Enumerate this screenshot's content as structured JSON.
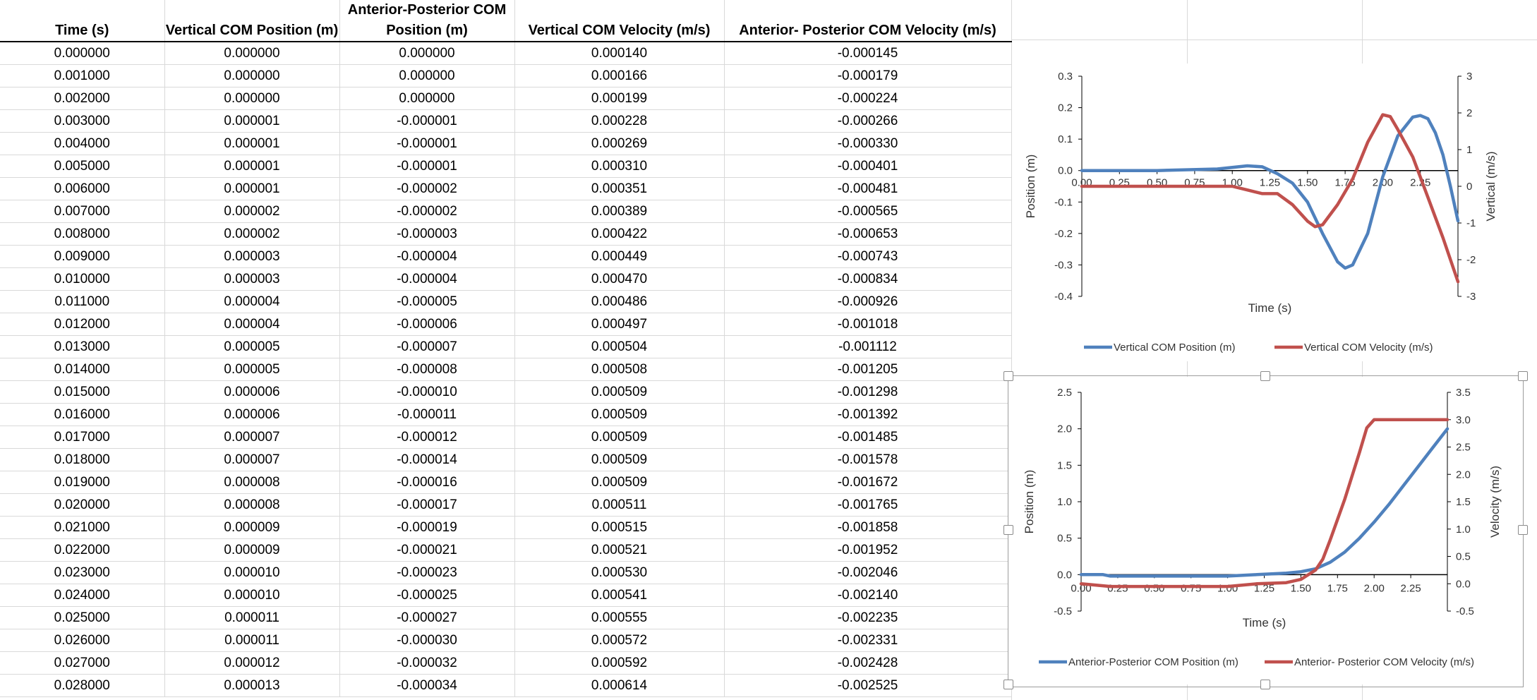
{
  "table": {
    "columns": [
      "Time (s)",
      "Vertical COM Position (m)",
      "Anterior-Posterior COM Position (m)",
      "Vertical COM Velocity (m/s)",
      "Anterior- Posterior COM Velocity (m/s)"
    ],
    "rows": [
      [
        "0.000000",
        "0.000000",
        "0.000000",
        "0.000140",
        "-0.000145"
      ],
      [
        "0.001000",
        "0.000000",
        "0.000000",
        "0.000166",
        "-0.000179"
      ],
      [
        "0.002000",
        "0.000000",
        "0.000000",
        "0.000199",
        "-0.000224"
      ],
      [
        "0.003000",
        "0.000001",
        "-0.000001",
        "0.000228",
        "-0.000266"
      ],
      [
        "0.004000",
        "0.000001",
        "-0.000001",
        "0.000269",
        "-0.000330"
      ],
      [
        "0.005000",
        "0.000001",
        "-0.000001",
        "0.000310",
        "-0.000401"
      ],
      [
        "0.006000",
        "0.000001",
        "-0.000002",
        "0.000351",
        "-0.000481"
      ],
      [
        "0.007000",
        "0.000002",
        "-0.000002",
        "0.000389",
        "-0.000565"
      ],
      [
        "0.008000",
        "0.000002",
        "-0.000003",
        "0.000422",
        "-0.000653"
      ],
      [
        "0.009000",
        "0.000003",
        "-0.000004",
        "0.000449",
        "-0.000743"
      ],
      [
        "0.010000",
        "0.000003",
        "-0.000004",
        "0.000470",
        "-0.000834"
      ],
      [
        "0.011000",
        "0.000004",
        "-0.000005",
        "0.000486",
        "-0.000926"
      ],
      [
        "0.012000",
        "0.000004",
        "-0.000006",
        "0.000497",
        "-0.001018"
      ],
      [
        "0.013000",
        "0.000005",
        "-0.000007",
        "0.000504",
        "-0.001112"
      ],
      [
        "0.014000",
        "0.000005",
        "-0.000008",
        "0.000508",
        "-0.001205"
      ],
      [
        "0.015000",
        "0.000006",
        "-0.000010",
        "0.000509",
        "-0.001298"
      ],
      [
        "0.016000",
        "0.000006",
        "-0.000011",
        "0.000509",
        "-0.001392"
      ],
      [
        "0.017000",
        "0.000007",
        "-0.000012",
        "0.000509",
        "-0.001485"
      ],
      [
        "0.018000",
        "0.000007",
        "-0.000014",
        "0.000509",
        "-0.001578"
      ],
      [
        "0.019000",
        "0.000008",
        "-0.000016",
        "0.000509",
        "-0.001672"
      ],
      [
        "0.020000",
        "0.000008",
        "-0.000017",
        "0.000511",
        "-0.001765"
      ],
      [
        "0.021000",
        "0.000009",
        "-0.000019",
        "0.000515",
        "-0.001858"
      ],
      [
        "0.022000",
        "0.000009",
        "-0.000021",
        "0.000521",
        "-0.001952"
      ],
      [
        "0.023000",
        "0.000010",
        "-0.000023",
        "0.000530",
        "-0.002046"
      ],
      [
        "0.024000",
        "0.000010",
        "-0.000025",
        "0.000541",
        "-0.002140"
      ],
      [
        "0.025000",
        "0.000011",
        "-0.000027",
        "0.000555",
        "-0.002235"
      ],
      [
        "0.026000",
        "0.000011",
        "-0.000030",
        "0.000572",
        "-0.002331"
      ],
      [
        "0.027000",
        "0.000012",
        "-0.000032",
        "0.000592",
        "-0.002428"
      ],
      [
        "0.028000",
        "0.000013",
        "-0.000034",
        "0.000614",
        "-0.002525"
      ]
    ]
  },
  "chart_data": [
    {
      "type": "line",
      "xlabel": "Time (s)",
      "ylabel": "Position (m)",
      "y2label": "Vertical (m/s)",
      "xlim": [
        0,
        2.5
      ],
      "ylim": [
        -0.4,
        0.3
      ],
      "y2lim": [
        -3,
        3
      ],
      "xticks": [
        "0.00",
        "0.25",
        "0.50",
        "0.75",
        "1.00",
        "1.25",
        "1.50",
        "1.75",
        "2.00",
        "2.25"
      ],
      "yticks": [
        "0.3",
        "0.2",
        "0.1",
        "0.0",
        "-0.1",
        "-0.2",
        "-0.3",
        "-0.4"
      ],
      "y2ticks": [
        "3",
        "2",
        "1",
        "0",
        "-1",
        "-2",
        "-3"
      ],
      "legend_position": "bottom",
      "series": [
        {
          "name": "Vertical COM Position (m)",
          "color": "#4f81bd",
          "axis": "left",
          "x": [
            0,
            0.5,
            0.9,
            1.0,
            1.1,
            1.2,
            1.3,
            1.4,
            1.5,
            1.6,
            1.7,
            1.75,
            1.8,
            1.9,
            2.0,
            2.1,
            2.2,
            2.25,
            2.3,
            2.35,
            2.4,
            2.45,
            2.5
          ],
          "y": [
            0,
            0,
            0.005,
            0.01,
            0.015,
            0.012,
            -0.01,
            -0.04,
            -0.1,
            -0.2,
            -0.29,
            -0.31,
            -0.3,
            -0.2,
            -0.02,
            0.11,
            0.17,
            0.175,
            0.165,
            0.12,
            0.05,
            -0.05,
            -0.16
          ]
        },
        {
          "name": "Vertical COM Velocity (m/s)",
          "color": "#c0504d",
          "axis": "right",
          "x": [
            0,
            1.0,
            1.1,
            1.2,
            1.25,
            1.3,
            1.4,
            1.5,
            1.55,
            1.6,
            1.7,
            1.8,
            1.9,
            2.0,
            2.05,
            2.1,
            2.2,
            2.3,
            2.4,
            2.5
          ],
          "y": [
            0,
            0,
            -0.1,
            -0.2,
            -0.2,
            -0.2,
            -0.5,
            -0.95,
            -1.1,
            -1.05,
            -0.5,
            0.2,
            1.2,
            1.95,
            1.9,
            1.55,
            0.8,
            -0.3,
            -1.4,
            -2.6
          ]
        }
      ]
    },
    {
      "type": "line",
      "xlabel": "Time (s)",
      "ylabel": "Position (m)",
      "y2label": "Velocity (m/s)",
      "xlim": [
        0,
        2.5
      ],
      "ylim": [
        -0.5,
        2.5
      ],
      "y2lim": [
        -0.5,
        3.5
      ],
      "xticks": [
        "0.00",
        "0.25",
        "0.50",
        "0.75",
        "1.00",
        "1.25",
        "1.50",
        "1.75",
        "2.00",
        "2.25"
      ],
      "yticks": [
        "2.5",
        "2.0",
        "1.5",
        "1.0",
        "0.5",
        "0.0",
        "-0.5"
      ],
      "y2ticks": [
        "3.5",
        "3.0",
        "2.5",
        "2.0",
        "1.5",
        "1.0",
        "0.5",
        "0.0",
        "-0.5"
      ],
      "legend_position": "bottom",
      "series": [
        {
          "name": "Anterior-Posterior COM Position (m)",
          "color": "#4f81bd",
          "axis": "left",
          "x": [
            0,
            0.15,
            0.2,
            1.0,
            1.2,
            1.4,
            1.5,
            1.6,
            1.7,
            1.8,
            1.9,
            2.0,
            2.1,
            2.2,
            2.3,
            2.4,
            2.5
          ],
          "y": [
            0,
            0,
            -0.02,
            -0.02,
            0.0,
            0.02,
            0.04,
            0.08,
            0.17,
            0.31,
            0.5,
            0.72,
            0.96,
            1.22,
            1.48,
            1.74,
            2.0
          ]
        },
        {
          "name": "Anterior- Posterior COM Velocity (m/s)",
          "color": "#c0504d",
          "axis": "right",
          "x": [
            0,
            0.2,
            0.9,
            1.0,
            1.2,
            1.4,
            1.5,
            1.6,
            1.65,
            1.7,
            1.8,
            1.9,
            1.95,
            2.0,
            2.5
          ],
          "y": [
            0,
            -0.05,
            -0.05,
            -0.05,
            0.0,
            0.02,
            0.08,
            0.25,
            0.45,
            0.8,
            1.55,
            2.4,
            2.85,
            3.0,
            3.0
          ]
        }
      ]
    }
  ]
}
